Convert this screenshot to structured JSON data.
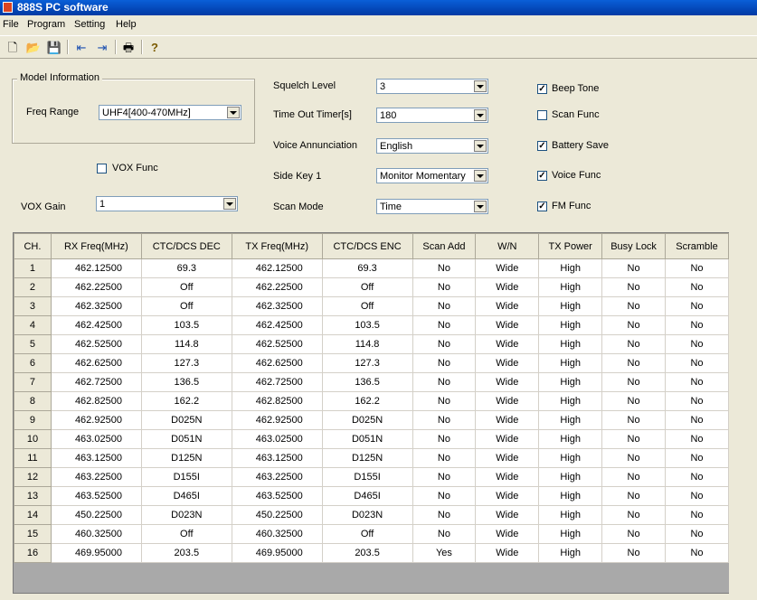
{
  "window": {
    "title": "888S PC software"
  },
  "menu": [
    "File",
    "Program",
    "Setting",
    "Help"
  ],
  "toolbar": [
    {
      "name": "new-file-icon",
      "glyph": "🗋"
    },
    {
      "name": "open-folder-icon",
      "glyph": "📂"
    },
    {
      "name": "save-icon",
      "glyph": "💾"
    },
    {
      "name": "read-from-radio-icon",
      "glyph": "⇤"
    },
    {
      "name": "write-to-radio-icon",
      "glyph": "⇥"
    },
    {
      "name": "print-icon",
      "glyph": "🖶"
    },
    {
      "name": "help-icon",
      "glyph": "?"
    }
  ],
  "model_info": {
    "legend": "Model Information",
    "freq_range_label": "Freq Range",
    "freq_range": "UHF4[400-470MHz]"
  },
  "vox": {
    "func_label": "VOX Func",
    "func_checked": false,
    "gain_label": "VOX Gain",
    "gain": "1"
  },
  "settings": {
    "squelch_label": "Squelch Level",
    "squelch": "3",
    "timeout_label": "Time Out Timer[s]",
    "timeout": "180",
    "voice_label": "Voice Annunciation",
    "voice": "English",
    "sidekey_label": "Side Key 1",
    "sidekey": "Monitor Momentary",
    "scanmode_label": "Scan Mode",
    "scanmode": "Time"
  },
  "checks": {
    "beep_label": "Beep Tone",
    "beep": true,
    "scanfunc_label": "Scan Func",
    "scanfunc": false,
    "battery_label": "Battery Save",
    "battery": true,
    "voicefunc_label": "Voice Func",
    "voicefunc": true,
    "fm_label": "FM Func",
    "fm": true
  },
  "table": {
    "headers": [
      "CH.",
      "RX Freq(MHz)",
      "CTC/DCS DEC",
      "TX Freq(MHz)",
      "CTC/DCS ENC",
      "Scan Add",
      "W/N",
      "TX Power",
      "Busy Lock",
      "Scramble"
    ],
    "rows": [
      [
        "1",
        "462.12500",
        "69.3",
        "462.12500",
        "69.3",
        "No",
        "Wide",
        "High",
        "No",
        "No"
      ],
      [
        "2",
        "462.22500",
        "Off",
        "462.22500",
        "Off",
        "No",
        "Wide",
        "High",
        "No",
        "No"
      ],
      [
        "3",
        "462.32500",
        "Off",
        "462.32500",
        "Off",
        "No",
        "Wide",
        "High",
        "No",
        "No"
      ],
      [
        "4",
        "462.42500",
        "103.5",
        "462.42500",
        "103.5",
        "No",
        "Wide",
        "High",
        "No",
        "No"
      ],
      [
        "5",
        "462.52500",
        "114.8",
        "462.52500",
        "114.8",
        "No",
        "Wide",
        "High",
        "No",
        "No"
      ],
      [
        "6",
        "462.62500",
        "127.3",
        "462.62500",
        "127.3",
        "No",
        "Wide",
        "High",
        "No",
        "No"
      ],
      [
        "7",
        "462.72500",
        "136.5",
        "462.72500",
        "136.5",
        "No",
        "Wide",
        "High",
        "No",
        "No"
      ],
      [
        "8",
        "462.82500",
        "162.2",
        "462.82500",
        "162.2",
        "No",
        "Wide",
        "High",
        "No",
        "No"
      ],
      [
        "9",
        "462.92500",
        "D025N",
        "462.92500",
        "D025N",
        "No",
        "Wide",
        "High",
        "No",
        "No"
      ],
      [
        "10",
        "463.02500",
        "D051N",
        "463.02500",
        "D051N",
        "No",
        "Wide",
        "High",
        "No",
        "No"
      ],
      [
        "11",
        "463.12500",
        "D125N",
        "463.12500",
        "D125N",
        "No",
        "Wide",
        "High",
        "No",
        "No"
      ],
      [
        "12",
        "463.22500",
        "D155I",
        "463.22500",
        "D155I",
        "No",
        "Wide",
        "High",
        "No",
        "No"
      ],
      [
        "13",
        "463.52500",
        "D465I",
        "463.52500",
        "D465I",
        "No",
        "Wide",
        "High",
        "No",
        "No"
      ],
      [
        "14",
        "450.22500",
        "D023N",
        "450.22500",
        "D023N",
        "No",
        "Wide",
        "High",
        "No",
        "No"
      ],
      [
        "15",
        "460.32500",
        "Off",
        "460.32500",
        "Off",
        "No",
        "Wide",
        "High",
        "No",
        "No"
      ],
      [
        "16",
        "469.95000",
        "203.5",
        "469.95000",
        "203.5",
        "Yes",
        "Wide",
        "High",
        "No",
        "No"
      ]
    ]
  },
  "colors": {
    "titlebar": "#0447b8",
    "window_bg": "#ece9d8",
    "grid_empty": "#a9a9a9"
  }
}
